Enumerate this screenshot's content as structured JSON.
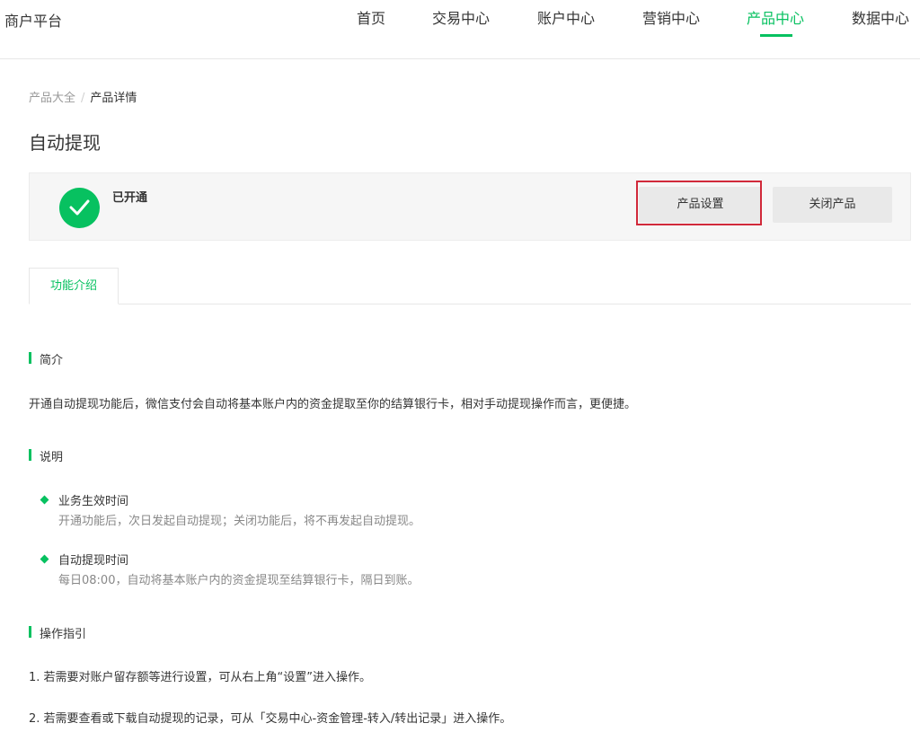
{
  "header": {
    "brand": "商户平台",
    "nav": [
      {
        "label": "首页"
      },
      {
        "label": "交易中心"
      },
      {
        "label": "账户中心"
      },
      {
        "label": "营销中心"
      },
      {
        "label": "产品中心",
        "active": true
      },
      {
        "label": "数据中心"
      }
    ]
  },
  "breadcrumb": {
    "parent": "产品大全",
    "separator": "/",
    "current": "产品详情"
  },
  "page_title": "自动提现",
  "status": {
    "label": "已开通",
    "settings_button": "产品设置",
    "close_button": "关闭产品"
  },
  "tabs": [
    {
      "label": "功能介绍"
    }
  ],
  "intro": {
    "heading": "简介",
    "text": "开通自动提现功能后，微信支付会自动将基本账户内的资金提取至你的结算银行卡，相对手动提现操作而言，更便捷。"
  },
  "explain": {
    "heading": "说明",
    "items": [
      {
        "title": "业务生效时间",
        "desc": "开通功能后，次日发起自动提现；关闭功能后，将不再发起自动提现。"
      },
      {
        "title": "自动提现时间",
        "desc": "每日08:00，自动将基本账户内的资金提现至结算银行卡，隔日到账。"
      }
    ]
  },
  "guide": {
    "heading": "操作指引",
    "steps": [
      "1. 若需要对账户留存额等进行设置，可从右上角“设置”进入操作。",
      "2. 若需要查看或下载自动提现的记录，可从「交易中心-资金管理-转入/转出记录」进入操作。"
    ]
  },
  "colors": {
    "accent": "#07c160",
    "highlight": "#d1293a"
  }
}
